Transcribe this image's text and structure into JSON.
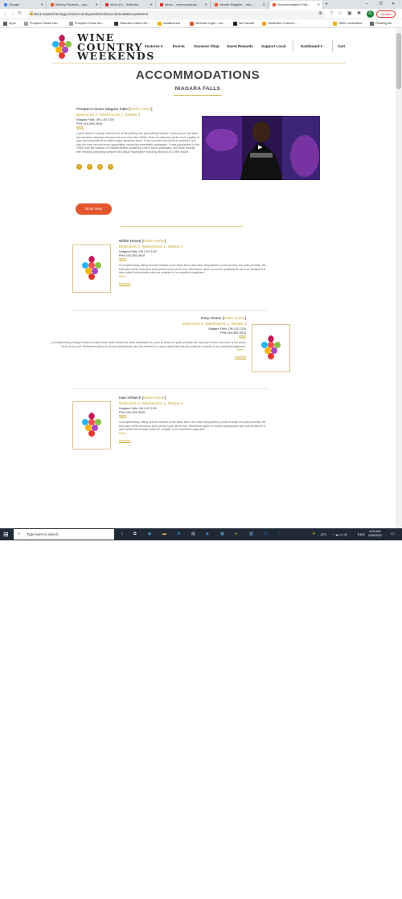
{
  "browser": {
    "tabs": [
      {
        "label": "Google",
        "color": "#4285f4"
      },
      {
        "label": "Winery Partners – wor...",
        "color": "#e4572e"
      },
      {
        "label": "Inbox (1) – tlytfe/lat/...",
        "color": "#d93025"
      },
      {
        "label": "Inbox – vineccountryw...",
        "color": "#d93025"
      },
      {
        "label": "Vendor Register – wor...",
        "color": "#e4572e"
      },
      {
        "label": "Accommodation Part...",
        "color": "#e4572e"
      }
    ],
    "new_tab": "+",
    "url": "dev1.ivantechnology.in/vinecountryweekends/accommodation-partners/",
    "update_label": "Update",
    "avatar_letter": "G",
    "bookmarks": [
      {
        "label": "Apps",
        "color": "#5f6368"
      },
      {
        "label": "Prospect House Nia...",
        "color": "#9e9e9e"
      },
      {
        "label": "Prospect House Am...",
        "color": "#9e9e9e"
      },
      {
        "label": "Fallsview Casino Re...",
        "color": "#333333"
      },
      {
        "label": "Adtalkrecent",
        "color": "#e8b400"
      },
      {
        "label": "Webmail Login – wo...",
        "color": "#e4572e"
      },
      {
        "label": "WeTransfer",
        "color": "#222222"
      },
      {
        "label": "HostGator Custome...",
        "color": "#f5a623"
      },
      {
        "label": "Other bookmarks",
        "color": "#e8b400"
      },
      {
        "label": "Reading list",
        "color": "#5f6368"
      }
    ]
  },
  "site": {
    "logo_lines": [
      "WINE",
      "COUNTRY",
      "WEEKENDS"
    ],
    "nav": [
      "Features",
      "Events",
      "Souvenir Shop",
      "Guest Rewards",
      "Support Local",
      "Dashboard",
      "Cart"
    ],
    "heading": "ACCOMMODATIONS",
    "subheading": "NIAGARA FALLS",
    "featured": {
      "name": "Prospect House Niagara Falls",
      "type_open": " [",
      "type": "Entire Home",
      "type_close": "]",
      "details": "Bedrooms 2, Washrooms 1, Sleeps 4",
      "address": "Niagara Falls, ON L2G 1G9",
      "phone": "PH# 416-409-3618",
      "price": "$$$",
      "description": "Lorem Ipsum is simply dummy text of the printing and typesetting industry. Lorem Ipsum has been the industry's standard dummy text ever since the 1500s, when an unknown printer took a galley of type and scrambled it to make a type specimen book. It has survived not only five centuries, but also the leap into electronic typesetting, remaining essentially unchanged. It was popularised in the 1960s with the release of Letraset sheets containing Lorem Ipsum passages, and more recently with desktop publishing software like Aldus PageMaker including versions of Lorem Ipsum.",
      "book_label": "Book Now"
    },
    "listings": [
      {
        "name": "White House",
        "type": "Entire Home",
        "details": "Bedrooms 2, Washrooms 1, Sleeps 4",
        "address": "Niagara Falls, ON L2G 1G9",
        "phone": "PH# 416-409-3618",
        "price": "$$$",
        "description": "A complimentary hiking kit that includes some basic items and other keepsakes is yours to keep but quite possibly, the best part of this excursion is the picnic lunch at the end. Whichever option is chosen participants can look forward to a wine safari that includes what we consider to be essential equipment.",
        "more": "More...",
        "inquiries": "Inquiries"
      },
      {
        "name": "Grey House",
        "type": "Entire Home",
        "details": "Bedrooms 2, Washrooms 1, Sleeps 4",
        "address": "Niagara Falls, ON L2G 1G9",
        "phone": "PH# 416-409-3618",
        "price": "$$$",
        "description": "A complimentary hiking kit that includes some basic items and other keepsakes is yours to keep but quite possibly, the best part of this excursion is the picnic lunch at the end. Whichever option is chosen participants can look forward to a wine safari that includes what we consider to be essential equipment.",
        "more": "More...",
        "inquiries": "Inquiries"
      },
      {
        "name": "Ivan Infotech",
        "type": "Entire Home",
        "details": "Bedrooms 2, Washrooms 1, Sleeps 4",
        "address": "Niagara Falls, ON L2G 1G9",
        "phone": "PH# 416-409-3618",
        "price": "$$$",
        "description": "A complimentary hiking kit that includes some basic items and other keepsakes is yours to keep but quite possibly, the best part of this excursion is the picnic lunch at the end. Whichever option is chosen participants can look forward to a wine safari that includes what we consider to be essential equipment.",
        "more": "More...",
        "inquiries": "Inquiries"
      }
    ]
  },
  "taskbar": {
    "search_placeholder": "Type here to search",
    "weather": "-6°C",
    "lang": "ENG",
    "time": "8:00 AM",
    "date": "2/26/2022"
  },
  "colors": {
    "gold": "#c9a227",
    "orange": "#e4572e",
    "taskbar": "#1f2a36"
  }
}
